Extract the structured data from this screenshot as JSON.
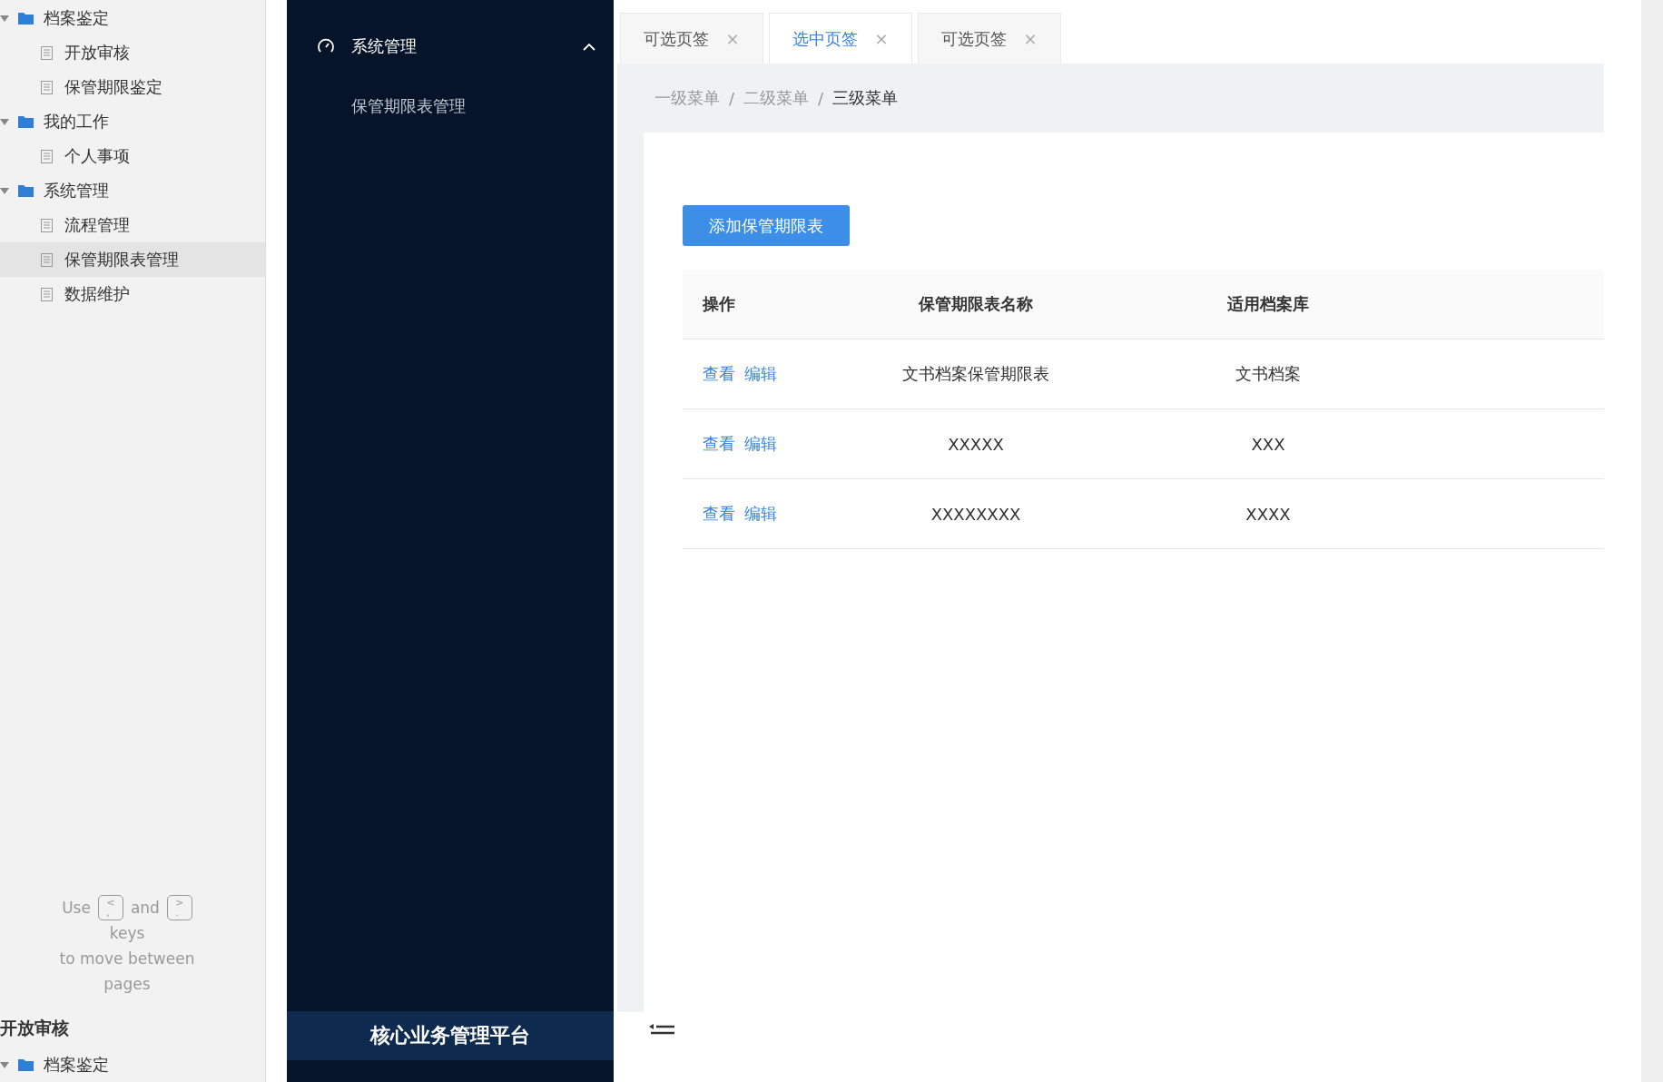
{
  "left_panel": {
    "tree": [
      {
        "label": "档案鉴定",
        "expanded": true,
        "children": [
          {
            "label": "开放审核",
            "selected": false
          },
          {
            "label": "保管期限鉴定",
            "selected": false
          }
        ]
      },
      {
        "label": "我的工作",
        "expanded": true,
        "children": [
          {
            "label": "个人事项",
            "selected": false
          }
        ]
      },
      {
        "label": "系统管理",
        "expanded": true,
        "children": [
          {
            "label": "流程管理",
            "selected": false
          },
          {
            "label": "保管期限表管理",
            "selected": true
          },
          {
            "label": "数据维护",
            "selected": false
          }
        ]
      }
    ],
    "hint": {
      "prefix": "Use",
      "key_prev": {
        "top": "<",
        "bottom": ","
      },
      "middle": "and",
      "key_next": {
        "top": ">",
        "bottom": "."
      },
      "lines": [
        "keys",
        "to move between",
        "pages"
      ]
    },
    "page_title": "开放审核",
    "tree_bottom": [
      {
        "label": "档案鉴定",
        "expanded": true
      }
    ]
  },
  "side_menu": {
    "label": "系统管理",
    "expanded": true,
    "items": [
      {
        "label": "保管期限表管理",
        "selected": false
      }
    ]
  },
  "platform_title": "核心业务管理平台",
  "tabs": [
    {
      "label": "可选页签",
      "close": "×",
      "selected": false
    },
    {
      "label": "选中页签",
      "close": "×",
      "selected": true
    },
    {
      "label": "可选页签",
      "close": "×",
      "selected": false
    }
  ],
  "breadcrumb": {
    "separator": "/",
    "items": [
      "一级菜单",
      "二级菜单",
      "三级菜单"
    ]
  },
  "add_button": "添加保管期限表",
  "table": {
    "columns": [
      "操作",
      "保管期限表名称",
      "适用档案库"
    ],
    "rows": [
      {
        "actions": [
          "查看",
          "编辑"
        ],
        "name": "文书档案保管期限表",
        "library": "文书档案"
      },
      {
        "actions": [
          "查看",
          "编辑"
        ],
        "name": "XXXXX",
        "library": "XXX"
      },
      {
        "actions": [
          "查看",
          "编辑"
        ],
        "name": "XXXXXXXX",
        "library": "XXXX"
      }
    ]
  }
}
